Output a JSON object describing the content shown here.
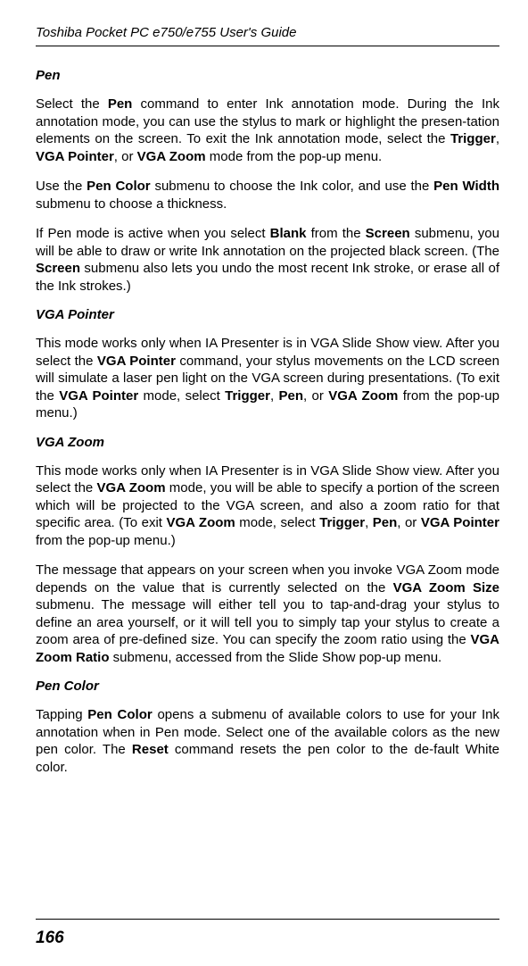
{
  "header": "Toshiba Pocket PC e750/e755  User's Guide",
  "pageNumber": "166",
  "sections": [
    {
      "heading": "Pen",
      "paragraphs": [
        [
          {
            "t": "Select the "
          },
          {
            "t": "Pen",
            "b": true
          },
          {
            "t": " command to enter Ink annotation mode. During the Ink annotation mode, you can use the stylus to mark or highlight the presen-tation elements on the screen. To exit the Ink annotation mode, select the "
          },
          {
            "t": "Trigger",
            "b": true
          },
          {
            "t": ", "
          },
          {
            "t": "VGA Pointer",
            "b": true
          },
          {
            "t": ", or "
          },
          {
            "t": "VGA Zoom",
            "b": true
          },
          {
            "t": " mode from the pop-up menu."
          }
        ],
        [
          {
            "t": "Use the "
          },
          {
            "t": "Pen Color",
            "b": true
          },
          {
            "t": " submenu to choose the Ink color, and use the "
          },
          {
            "t": "Pen Width",
            "b": true
          },
          {
            "t": " submenu to choose a thickness."
          }
        ],
        [
          {
            "t": "If Pen mode is active when you select "
          },
          {
            "t": "Blank",
            "b": true
          },
          {
            "t": " from the "
          },
          {
            "t": "Screen",
            "b": true
          },
          {
            "t": " submenu, you will be able to draw or write Ink annotation on the projected black screen. (The "
          },
          {
            "t": "Screen",
            "b": true
          },
          {
            "t": " submenu also lets you undo the most recent Ink stroke, or erase all of the Ink strokes.)"
          }
        ]
      ]
    },
    {
      "heading": "VGA Pointer",
      "paragraphs": [
        [
          {
            "t": "This mode works only when IA Presenter is in VGA Slide Show view. After you select the "
          },
          {
            "t": "VGA Pointer",
            "b": true
          },
          {
            "t": " command, your stylus movements on the LCD screen will simulate a laser pen light on the VGA screen during presentations. (To exit the "
          },
          {
            "t": "VGA Pointer",
            "b": true
          },
          {
            "t": " mode, select "
          },
          {
            "t": "Trigger",
            "b": true
          },
          {
            "t": ", "
          },
          {
            "t": "Pen",
            "b": true
          },
          {
            "t": ", or "
          },
          {
            "t": "VGA Zoom",
            "b": true
          },
          {
            "t": " from the pop-up menu.)"
          }
        ]
      ]
    },
    {
      "heading": "VGA Zoom",
      "paragraphs": [
        [
          {
            "t": "This mode works only when IA Presenter is in VGA Slide Show view. After you select the "
          },
          {
            "t": "VGA Zoom",
            "b": true
          },
          {
            "t": " mode, you will be able to specify a portion of the screen which will be projected to the VGA screen, and also a zoom ratio for that specific area. (To exit "
          },
          {
            "t": "VGA Zoom",
            "b": true
          },
          {
            "t": " mode, select "
          },
          {
            "t": "Trigger",
            "b": true
          },
          {
            "t": ", "
          },
          {
            "t": "Pen",
            "b": true
          },
          {
            "t": ", or "
          },
          {
            "t": "VGA Pointer",
            "b": true
          },
          {
            "t": " from the pop-up menu.)"
          }
        ],
        [
          {
            "t": "The message that appears on your screen when you invoke VGA Zoom mode depends on the value that is currently selected on the "
          },
          {
            "t": "VGA Zoom Size",
            "b": true
          },
          {
            "t": " submenu. The message will either tell you to tap-and-drag your stylus to define an area yourself, or it will tell you to simply tap your stylus to create a zoom area of pre-defined size. You can specify the zoom ratio using the "
          },
          {
            "t": "VGA Zoom Ratio",
            "b": true
          },
          {
            "t": " submenu, accessed from the Slide Show pop-up menu."
          }
        ]
      ]
    },
    {
      "heading": "Pen Color",
      "paragraphs": [
        [
          {
            "t": "Tapping "
          },
          {
            "t": "Pen Color",
            "b": true
          },
          {
            "t": " opens a submenu of available colors to use for your Ink annotation when in Pen mode. Select one of the available colors as the new pen color. The "
          },
          {
            "t": "Reset",
            "b": true
          },
          {
            "t": " command resets the pen color to the de-fault White color."
          }
        ]
      ]
    }
  ]
}
